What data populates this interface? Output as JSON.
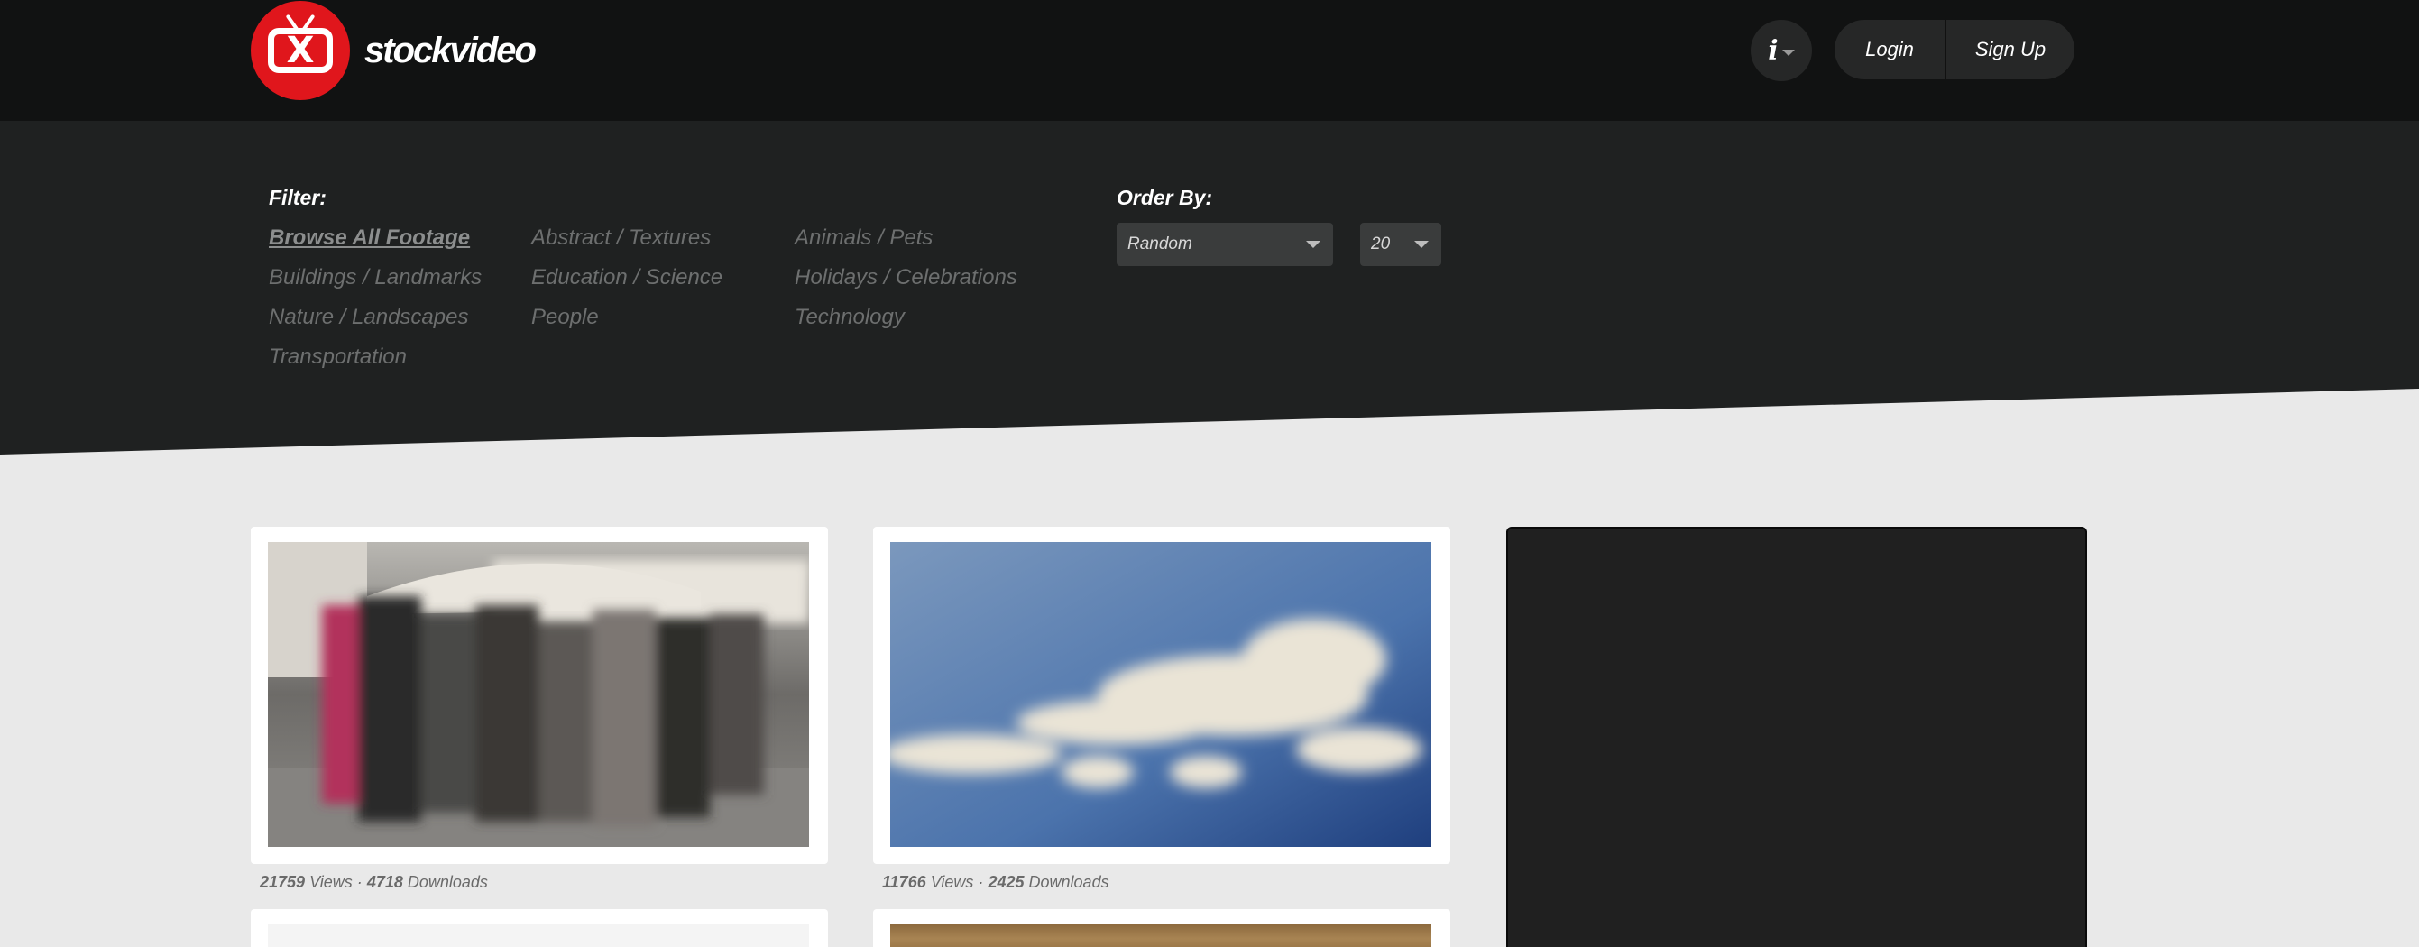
{
  "brand": {
    "name": "stockvideo",
    "logo_letter": "X"
  },
  "header": {
    "info_label": "i",
    "login_label": "Login",
    "signup_label": "Sign Up"
  },
  "filter": {
    "label": "Filter:",
    "items": [
      "Browse All Footage",
      "Abstract / Textures",
      "Animals / Pets",
      "Buildings / Landmarks",
      "Education / Science",
      "Holidays / Celebrations",
      "Nature / Landscapes",
      "People",
      "Technology",
      "Transportation"
    ]
  },
  "order": {
    "label": "Order By:",
    "sort_value": "Random",
    "count_value": "20"
  },
  "videos": [
    {
      "views": "21759",
      "views_label": "Views",
      "sep": "·",
      "downloads": "4718",
      "downloads_label": "Downloads"
    },
    {
      "views": "11766",
      "views_label": "Views",
      "sep": "·",
      "downloads": "2425",
      "downloads_label": "Downloads"
    }
  ],
  "colors": {
    "header_bg": "#111212",
    "filter_bg": "#1f2121",
    "page_bg": "#e9e9e9",
    "brand_red": "#e0161c"
  },
  "icons": [
    "tv-logo-icon",
    "info-icon",
    "caret-down-icon"
  ]
}
